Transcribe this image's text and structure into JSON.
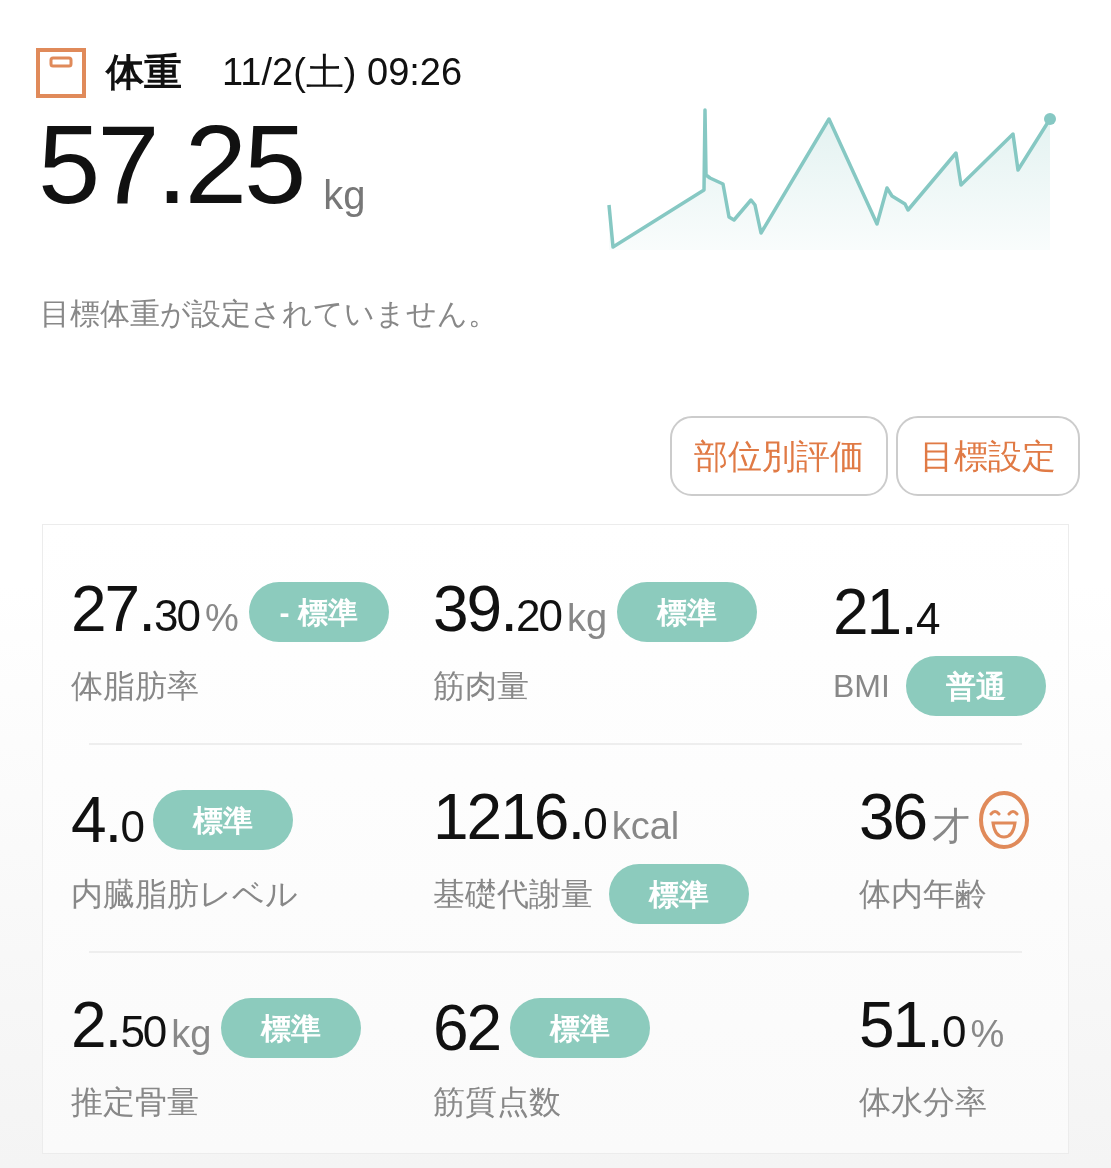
{
  "header": {
    "title": "体重",
    "datetime": "11/2(土) 09:26"
  },
  "weight": {
    "value": "57.25",
    "unit": "kg"
  },
  "goal_note": "目標体重が設定されていません。",
  "buttons": [
    "部位別評価",
    "目標設定"
  ],
  "metrics": [
    {
      "kind": "inline",
      "whole": "27.",
      "fraction": "30",
      "unit": "%",
      "label": "体脂肪率",
      "badge": "- 標準"
    },
    {
      "kind": "inline",
      "whole": "39.",
      "fraction": "20",
      "unit": "kg",
      "label": "筋肉量",
      "badge": "標準"
    },
    {
      "kind": "stacked",
      "whole": "21.",
      "fraction": "4",
      "label": "BMI",
      "badge": "普通"
    },
    {
      "kind": "inline",
      "whole": "4.",
      "fraction": "0",
      "label": "内臓脂肪レベル",
      "badge": "標準"
    },
    {
      "kind": "stacked",
      "whole": "1216.",
      "fraction": "0",
      "unit": "kcal",
      "label": "基礎代謝量",
      "badge": "標準"
    },
    {
      "kind": "age",
      "whole": "36",
      "unit": "才",
      "label": "体内年齢"
    },
    {
      "kind": "inline",
      "whole": "2.",
      "fraction": "50",
      "unit": "kg",
      "label": "推定骨量",
      "badge": "標準"
    },
    {
      "kind": "inline",
      "whole": "62",
      "label": "筋質点数",
      "badge": "標準"
    },
    {
      "kind": "plain",
      "whole": "51.",
      "fraction": "0",
      "unit": "%",
      "label": "体水分率"
    }
  ]
}
